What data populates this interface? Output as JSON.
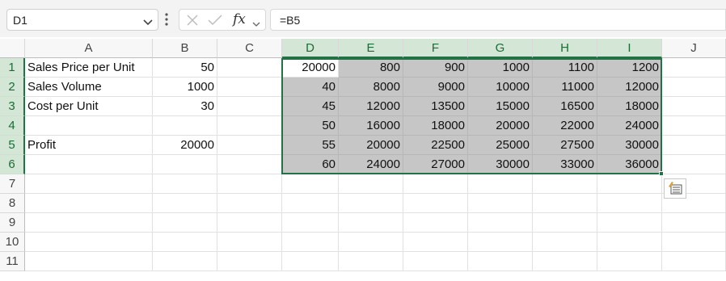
{
  "formula_bar": {
    "name_box": "D1",
    "fx_label": "fx",
    "formula": "=B5"
  },
  "columns": [
    "A",
    "B",
    "C",
    "D",
    "E",
    "F",
    "G",
    "H",
    "I",
    "J"
  ],
  "rows": [
    "1",
    "2",
    "3",
    "4",
    "5",
    "6",
    "7",
    "8",
    "9",
    "10",
    "11"
  ],
  "cells": {
    "A1": "Sales Price per Unit",
    "B1": "50",
    "A2": "Sales Volume",
    "B2": "1000",
    "A3": "Cost per Unit",
    "B3": "30",
    "A5": "Profit",
    "B5": "20000",
    "D1": "20000",
    "E1": "800",
    "F1": "900",
    "G1": "1000",
    "H1": "1100",
    "I1": "1200",
    "D2": "40",
    "E2": "8000",
    "F2": "9000",
    "G2": "10000",
    "H2": "11000",
    "I2": "12000",
    "D3": "45",
    "E3": "12000",
    "F3": "13500",
    "G3": "15000",
    "H3": "16500",
    "I3": "18000",
    "D4": "50",
    "E4": "16000",
    "F4": "18000",
    "G4": "20000",
    "H4": "22000",
    "I4": "24000",
    "D5": "55",
    "E5": "20000",
    "F5": "22500",
    "G5": "25000",
    "H5": "27500",
    "I5": "30000",
    "D6": "60",
    "E6": "24000",
    "F6": "27000",
    "G6": "30000",
    "H6": "33000",
    "I6": "36000"
  },
  "selection": {
    "range": "D1:I6",
    "active_cell": "D1"
  },
  "colors": {
    "accent": "#217346",
    "selected_header": "#d4e7d7",
    "range_fill": "#c6c6c6"
  }
}
